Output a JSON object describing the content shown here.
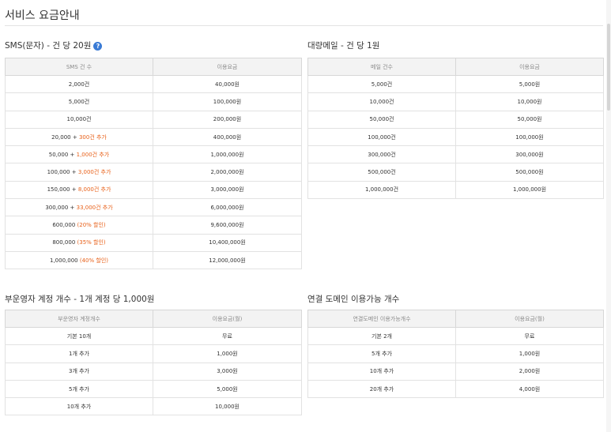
{
  "page": {
    "title": "서비스 요금안내"
  },
  "sms": {
    "heading": "SMS(문자) - 건 당 20원",
    "help_icon": "question-circle-icon",
    "headers": [
      "SMS 건 수",
      "이용요금"
    ],
    "rows": [
      {
        "count": "2,000건",
        "extra": "",
        "price": "40,000원"
      },
      {
        "count": "5,000건",
        "extra": "",
        "price": "100,000원"
      },
      {
        "count": "10,000건",
        "extra": "",
        "price": "200,000원"
      },
      {
        "count": "20,000 + ",
        "extra": "300건 추가",
        "price": "400,000원"
      },
      {
        "count": "50,000 + ",
        "extra": "1,000건 추가",
        "price": "1,000,000원"
      },
      {
        "count": "100,000 + ",
        "extra": "3,000건 추가",
        "price": "2,000,000원"
      },
      {
        "count": "150,000 + ",
        "extra": "8,000건 추가",
        "price": "3,000,000원"
      },
      {
        "count": "300,000 + ",
        "extra": "33,000건 추가",
        "price": "6,000,000원"
      },
      {
        "count": "600,000 ",
        "extra": "(20% 할인)",
        "price": "9,600,000원"
      },
      {
        "count": "800,000 ",
        "extra": "(35% 할인)",
        "price": "10,400,000원"
      },
      {
        "count": "1,000,000 ",
        "extra": "(40% 할인)",
        "price": "12,000,000원"
      }
    ]
  },
  "mail": {
    "heading": "대량메일 - 건 당 1원",
    "headers": [
      "메일 건수",
      "이용요금"
    ],
    "rows": [
      {
        "count": "5,000건",
        "price": "5,000원"
      },
      {
        "count": "10,000건",
        "price": "10,000원"
      },
      {
        "count": "50,000건",
        "price": "50,000원"
      },
      {
        "count": "100,000건",
        "price": "100,000원"
      },
      {
        "count": "300,000건",
        "price": "300,000원"
      },
      {
        "count": "500,000건",
        "price": "500,000원"
      },
      {
        "count": "1,000,000건",
        "price": "1,000,000원"
      }
    ]
  },
  "operator": {
    "heading": "부운영자 계정 개수 - 1개 계정 당 1,000원",
    "headers": [
      "부운영자 계정개수",
      "이용요금(월)"
    ],
    "rows": [
      {
        "count": "기본 10개",
        "price": "무료"
      },
      {
        "count": "1개 추가",
        "price": "1,000원"
      },
      {
        "count": "3개 추가",
        "price": "3,000원"
      },
      {
        "count": "5개 추가",
        "price": "5,000원"
      },
      {
        "count": "10개 추가",
        "price": "10,000원"
      }
    ]
  },
  "domain": {
    "heading": "연결 도메인 이용가능 개수",
    "headers": [
      "연결도메인 이용가능개수",
      "이용요금(월)"
    ],
    "rows": [
      {
        "count": "기본 2개",
        "price": "무료"
      },
      {
        "count": "5개 추가",
        "price": "1,000원"
      },
      {
        "count": "10개 추가",
        "price": "2,000원"
      },
      {
        "count": "20개 추가",
        "price": "4,000원"
      }
    ]
  },
  "colors": {
    "accent_orange": "#e8611a",
    "help_blue": "#3a7bd5",
    "header_bg": "#f3f3f3"
  }
}
